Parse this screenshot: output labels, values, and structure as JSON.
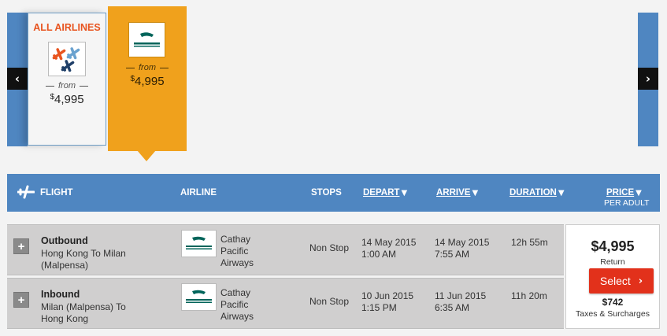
{
  "carousel": {
    "prev_icon": "‹",
    "next_icon": "›",
    "cards": [
      {
        "title": "ALL AIRLINES",
        "from_label": "from",
        "currency": "$",
        "price": "4,995",
        "logo": "multi-plane-icon"
      },
      {
        "title": "",
        "from_label": "from",
        "currency": "$",
        "price": "4,995",
        "logo": "cathay-pacific-logo",
        "selected": true
      }
    ]
  },
  "header": {
    "flight": "FLIGHT",
    "airline": "AIRLINE",
    "stops": "STOPS",
    "depart": "DEPART",
    "arrive": "ARRIVE",
    "duration": "DURATION",
    "price": "PRICE",
    "per_adult": "PER ADULT",
    "sort_arrow": "▼"
  },
  "rows": [
    {
      "direction": "Outbound",
      "route": "Hong Kong To Milan (Malpensa)",
      "airline": "Cathay Pacific Airways",
      "stops": "Non Stop",
      "depart_date": "14 May 2015",
      "depart_time": "1:00 AM",
      "arrive_date": "14 May 2015",
      "arrive_time": "7:55 AM",
      "duration": "12h 55m"
    },
    {
      "direction": "Inbound",
      "route": "Milan (Malpensa) To Hong Kong",
      "airline": "Cathay Pacific Airways",
      "stops": "Non Stop",
      "depart_date": "10 Jun 2015",
      "depart_time": "1:15 PM",
      "arrive_date": "11 Jun 2015",
      "arrive_time": "6:35 AM",
      "duration": "11h 20m"
    }
  ],
  "price_panel": {
    "total": "$4,995",
    "total_label": "Return",
    "select_label": "Select",
    "select_icon": "›",
    "taxes": "$742",
    "taxes_label": "Taxes & Surcharges"
  },
  "colors": {
    "accent_blue": "#4f86c1",
    "selected_orange": "#f0a11c",
    "all_airlines_red": "#e8541f",
    "select_red": "#e2311b"
  }
}
